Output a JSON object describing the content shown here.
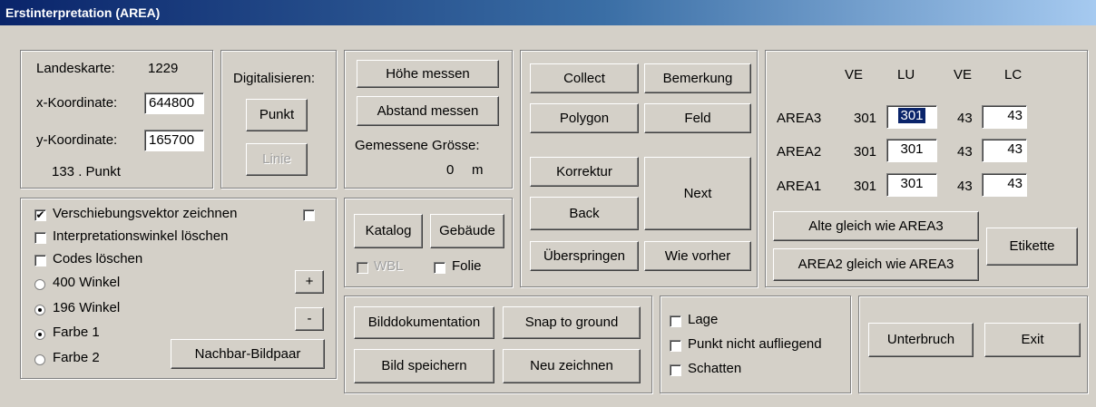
{
  "window": {
    "title": "Erstinterpretation (AREA)"
  },
  "coords": {
    "landeskarte_label": "Landeskarte:",
    "landeskarte_value": "1229",
    "x_label": "x-Koordinate:",
    "x_value": "644800",
    "y_label": "y-Koordinate:",
    "y_value": "165700",
    "punkt_count": "133 . Punkt"
  },
  "digitize": {
    "title": "Digitalisieren:",
    "punkt": "Punkt",
    "linie": "Linie"
  },
  "measure": {
    "hoehe": "Höhe messen",
    "abstand": "Abstand messen",
    "gemessene": "Gemessene Grösse:",
    "value": "0",
    "unit": "m"
  },
  "actions": {
    "collect": "Collect",
    "bemerkung": "Bemerkung",
    "polygon": "Polygon",
    "feld": "Feld",
    "korrektur": "Korrektur",
    "next": "Next",
    "back": "Back",
    "ueberspringen": "Überspringen",
    "wie_vorher": "Wie vorher"
  },
  "area": {
    "headers": [
      "VE",
      "LU",
      "VE",
      "LC"
    ],
    "rows": [
      {
        "name": "AREA3",
        "ve1": "301",
        "lu": "301",
        "ve2": "43",
        "lc": "43"
      },
      {
        "name": "AREA2",
        "ve1": "301",
        "lu": "301",
        "ve2": "43",
        "lc": "43"
      },
      {
        "name": "AREA1",
        "ve1": "301",
        "lu": "301",
        "ve2": "43",
        "lc": "43"
      }
    ],
    "alte_gleich": "Alte gleich wie AREA3",
    "area2_gleich": "AREA2 gleich wie AREA3",
    "etikette": "Etikette"
  },
  "options": {
    "verschiebung": "Verschiebungsvektor zeichnen",
    "interpretationswinkel": "Interpretationswinkel löschen",
    "codes": "Codes löschen",
    "winkel400": "400 Winkel",
    "winkel196": "196 Winkel",
    "farbe1": "Farbe 1",
    "farbe2": "Farbe 2",
    "plus": "+",
    "minus": "-",
    "nachbar": "Nachbar-Bildpaar"
  },
  "catalog": {
    "katalog": "Katalog",
    "gebaeude": "Gebäude",
    "wbl": "WBL",
    "folie": "Folie"
  },
  "doc": {
    "bilddoku": "Bilddokumentation",
    "snap": "Snap to ground",
    "speichern": "Bild speichern",
    "neu": "Neu zeichnen"
  },
  "flags": {
    "lage": "Lage",
    "punkt_nicht": "Punkt nicht aufliegend",
    "schatten": "Schatten"
  },
  "exit": {
    "unterbruch": "Unterbruch",
    "exit": "Exit"
  }
}
